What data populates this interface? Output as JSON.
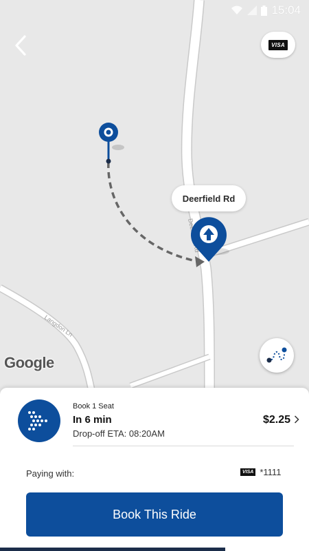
{
  "status_bar": {
    "time": "15:04"
  },
  "header": {
    "back_icon": "back-arrow-icon",
    "payment_card_brand": "VISA"
  },
  "map": {
    "location_label": "Deerfield Rd",
    "road_label_1": "Deerfield Rd",
    "road_label_2": "Langdon Ln",
    "attribution": "Google",
    "route_button_icon": "route-icon"
  },
  "ride_option": {
    "seat": "Book 1 Seat",
    "arrival": "In 6 min",
    "dropoff_eta": "Drop-off ETA: 08:20AM",
    "price": "$2.25"
  },
  "payment": {
    "label": "Paying with:",
    "card_brand": "VISA",
    "card_last4": "*1111"
  },
  "actions": {
    "book_label": "Book This Ride"
  },
  "colors": {
    "brand_blue": "#0d4e9c",
    "map_background": "#e8e8e8",
    "road": "#ffffff"
  }
}
